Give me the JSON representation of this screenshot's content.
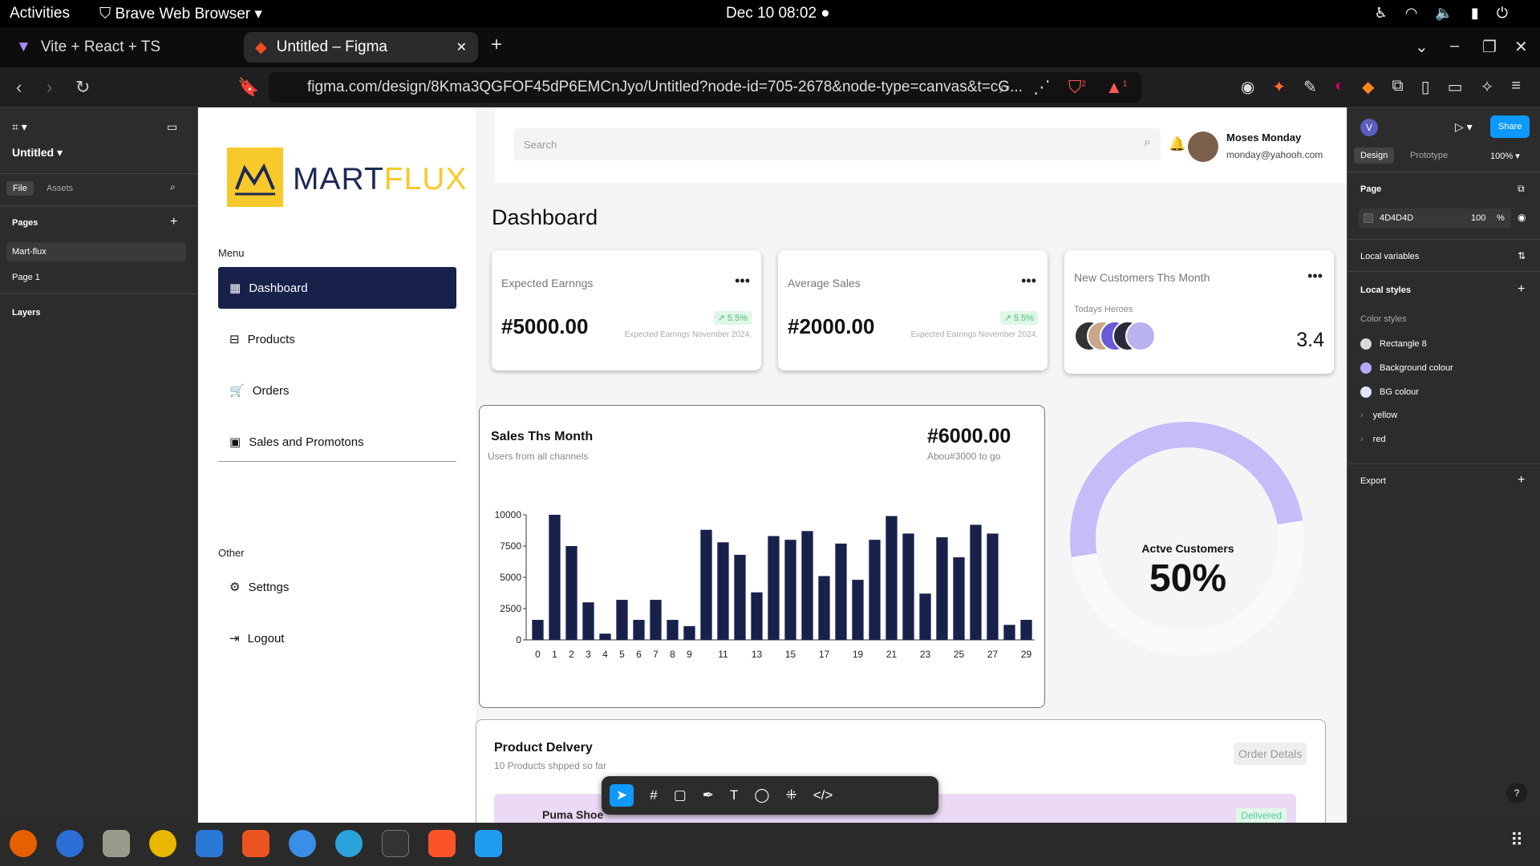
{
  "system": {
    "activities": "Activities",
    "app_name": "Brave Web Browser",
    "clock": "Dec 10  08:02"
  },
  "browser": {
    "tabs": [
      {
        "label": "Vite + React + TS"
      },
      {
        "label": "Untitled – Figma"
      }
    ],
    "url": "figma.com/design/8Kma3QGFOF45dP6EMCnJyo/Untitled?node-id=705-2678&node-type=canvas&t=cG...",
    "badges": {
      "shield": "2",
      "alert": "1"
    }
  },
  "figma_left": {
    "file_name": "Untitled",
    "tabs": [
      "File",
      "Assets"
    ],
    "pages_label": "Pages",
    "pages": [
      "Mart-flux",
      "Page 1"
    ],
    "layers_label": "Layers"
  },
  "figma_right": {
    "avatar": "V",
    "share": "Share",
    "tabs": [
      "Design",
      "Prototype"
    ],
    "zoom": "100%",
    "page_label": "Page",
    "page_color": "4D4D4D",
    "page_opacity": "100",
    "page_opacity_unit": "%",
    "local_variables": "Local variables",
    "local_styles": "Local styles",
    "color_styles": "Color styles",
    "styles": [
      {
        "name": "Rectangle 8",
        "color": "#d9d9d9"
      },
      {
        "name": "Background colour",
        "color": "#b9a8f5"
      },
      {
        "name": "BG colour",
        "color": "#dfe3ff"
      },
      {
        "name": "yellow",
        "color": ""
      },
      {
        "name": "red",
        "color": ""
      }
    ],
    "export": "Export"
  },
  "app": {
    "logo": {
      "part1": "MART",
      "part2": "FLUX"
    },
    "menu_label": "Menu",
    "menu": [
      {
        "label": "Dashboard",
        "icon": "grid-icon"
      },
      {
        "label": "Products",
        "icon": "box-icon"
      },
      {
        "label": "Orders",
        "icon": "cart-icon"
      },
      {
        "label": "Sales and Promotons",
        "icon": "ticket-icon"
      }
    ],
    "other_label": "Other",
    "other": [
      {
        "label": "Settngs",
        "icon": "gear-icon"
      },
      {
        "label": "Logout",
        "icon": "logout-icon"
      }
    ],
    "search_placeholder": "Search",
    "user": {
      "name": "Moses Monday",
      "email": "monday@yahooh.com"
    },
    "page_title": "Dashboard",
    "cards": [
      {
        "title": "Expected Earnngs",
        "value": "#5000.00",
        "sub": "Expected Earnngs November 2024.",
        "pct": "5.5%"
      },
      {
        "title": "Average Sales",
        "value": "#2000.00",
        "sub": "Expected Earnngs November 2024.",
        "pct": "5.5%"
      },
      {
        "title": "New Customers Ths Month",
        "heroes": "Todays Heroes",
        "value": "3.4"
      }
    ],
    "sales": {
      "title": "Sales Ths Month",
      "subtitle": "Users from all channels",
      "total": "#6000.00",
      "note": "Abou#3000 to go"
    },
    "active": {
      "label": "Actve Customers",
      "value": "50%",
      "fraction": 0.5
    },
    "delivery": {
      "title": "Product Delvery",
      "subtitle": "10 Products shpped so far",
      "button": "Order Detals",
      "item": "Puma Shoe",
      "status": "Delivered"
    }
  },
  "chart_data": {
    "type": "bar",
    "x": [
      0,
      1,
      2,
      3,
      4,
      5,
      6,
      7,
      8,
      9,
      10,
      11,
      12,
      13,
      14,
      15,
      16,
      17,
      18,
      19,
      20,
      21,
      22,
      23,
      24,
      25,
      26,
      27,
      28,
      29
    ],
    "xtick_labels": [
      "0",
      "1",
      "2",
      "3",
      "4",
      "5",
      "6",
      "7",
      "8",
      "9",
      "11",
      "13",
      "15",
      "17",
      "19",
      "21",
      "23",
      "25",
      "27",
      "29"
    ],
    "values": [
      1600,
      10000,
      7500,
      3000,
      500,
      3200,
      1600,
      3200,
      1600,
      1100,
      8800,
      7800,
      6800,
      3800,
      8300,
      8000,
      8700,
      5100,
      7700,
      4800,
      8000,
      9900,
      8500,
      3700,
      8200,
      6600,
      9200,
      8500,
      1200,
      1600
    ],
    "ylim": [
      0,
      10000
    ],
    "yticks": [
      "0",
      "2500",
      "5000",
      "7500",
      "10000"
    ],
    "color": "#18214a"
  }
}
